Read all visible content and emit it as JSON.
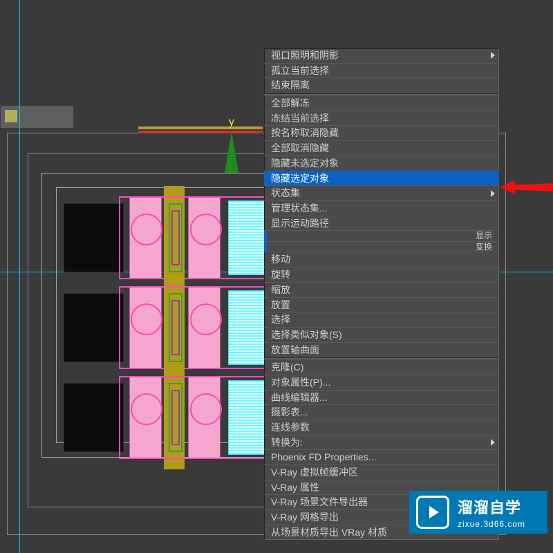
{
  "axis": {
    "y": "y"
  },
  "context_menu": {
    "items": [
      {
        "label": "视口照明和阴影",
        "submenu": true
      },
      {
        "label": "孤立当前选择"
      },
      {
        "label": "结束隔离"
      },
      "sep",
      {
        "label": "全部解冻"
      },
      {
        "label": "冻结当前选择"
      },
      {
        "label": "按名称取消隐藏"
      },
      {
        "label": "全部取消隐藏"
      },
      {
        "label": "隐藏未选定对象"
      },
      {
        "label": "隐藏选定对象",
        "selected": true
      },
      {
        "label": "状态集",
        "submenu": true
      },
      {
        "label": "管理状态集..."
      },
      {
        "label": "显示运动路径"
      },
      "right:显示",
      "right:变换",
      {
        "label": "移动"
      },
      {
        "label": "旋转"
      },
      {
        "label": "缩放"
      },
      {
        "label": "放置"
      },
      {
        "label": "选择"
      },
      {
        "label": "选择类似对象(S)"
      },
      {
        "label": "放置轴曲面"
      },
      "sep",
      {
        "label": "克隆(C)"
      },
      {
        "label": "对象属性(P)..."
      },
      {
        "label": "曲线编辑器..."
      },
      {
        "label": "摄影表..."
      },
      {
        "label": "连线参数"
      },
      {
        "label": "转换为:",
        "submenu": true
      },
      {
        "label": "Phoenix FD Properties..."
      },
      {
        "label": "V-Ray 虚拟帧缓冲区"
      },
      {
        "label": "V-Ray 属性"
      },
      {
        "label": "V-Ray 场景文件导出器"
      },
      {
        "label": "V-Ray 网格导出"
      },
      {
        "label": "从场景材质导出 VRay 材质"
      }
    ]
  },
  "logo": {
    "title": "溜溜自学",
    "url": "zixue.3d66.com"
  }
}
